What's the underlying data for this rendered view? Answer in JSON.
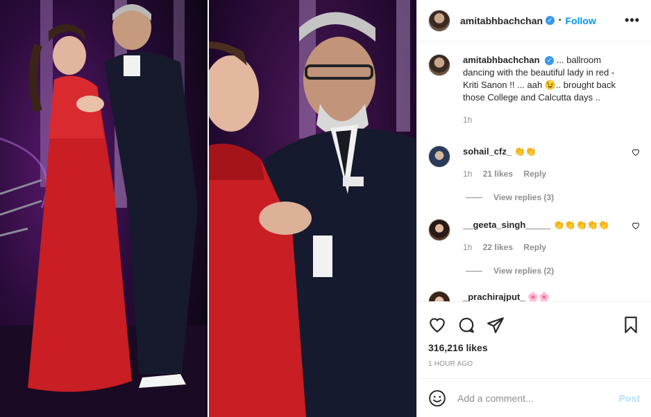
{
  "header": {
    "username": "amitabhbachchan",
    "follow_label": "Follow",
    "separator": "•",
    "more_label": "•••"
  },
  "caption": {
    "username": "amitabhbachchan",
    "text": "... ballroom dancing with the beautiful lady in red - Kriti Sanon !! ... aah 😉.. brought back those College and Calcutta days ..",
    "time": "1h"
  },
  "comments": [
    {
      "username": "sohail_cfz_",
      "text": "👏👏",
      "time": "1h",
      "likes": "21 likes",
      "reply_label": "Reply",
      "view_replies": "View replies (3)"
    },
    {
      "username": "__geeta_singh_____",
      "text": "👏👏👏👏👏",
      "time": "1h",
      "likes": "22 likes",
      "reply_label": "Reply",
      "view_replies": "View replies (2)"
    },
    {
      "username": "_prachirajput_",
      "text": "🌸🌸",
      "time": "",
      "likes": "",
      "reply_label": "",
      "view_replies": ""
    }
  ],
  "footer": {
    "likes": "316,216 likes",
    "time_ago": "1 HOUR AGO",
    "comment_placeholder": "Add a comment...",
    "post_label": "Post"
  },
  "icons": {
    "like": "heart-icon",
    "comment": "comment-icon",
    "share": "share-icon",
    "save": "bookmark-icon",
    "emoji": "emoji-icon",
    "verified": "verified-badge-icon"
  },
  "colors": {
    "link_blue": "#0095f6",
    "verified_blue": "#3897f0",
    "muted_gray": "#8e8e8e",
    "post_disabled": "#b2dffc"
  }
}
